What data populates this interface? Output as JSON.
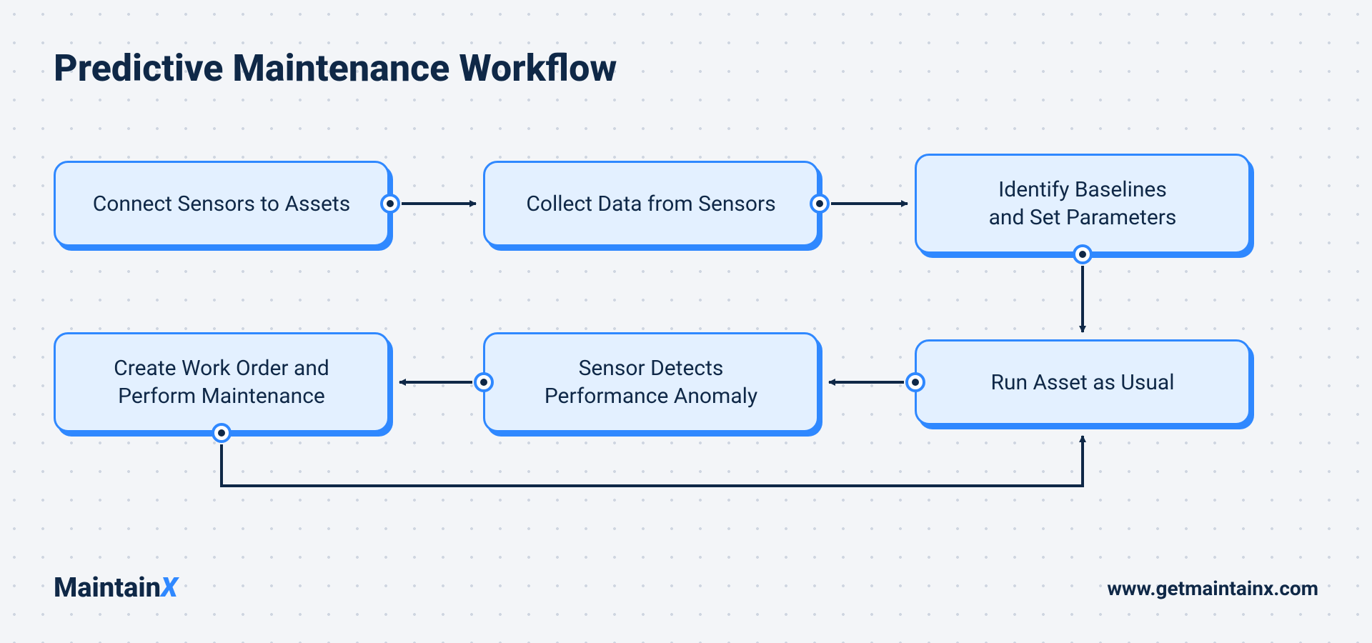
{
  "title": "Predictive Maintenance Workflow",
  "boxes": {
    "b1": "Connect Sensors to Assets",
    "b2": "Collect Data from Sensors",
    "b3_l1": "Identify Baselines",
    "b3_l2": "and Set Parameters",
    "b4": "Run Asset as Usual",
    "b5_l1": "Sensor Detects",
    "b5_l2": "Performance Anomaly",
    "b6_l1": "Create Work Order and",
    "b6_l2": "Perform Maintenance"
  },
  "brand": "Maintain",
  "brand_x": "X",
  "url": "www.getmaintainx.com",
  "colors": {
    "dark": "#0f2847",
    "accent": "#2f88ff",
    "box_bg": "#e3f0ff",
    "page_bg": "#f3f5f8"
  }
}
